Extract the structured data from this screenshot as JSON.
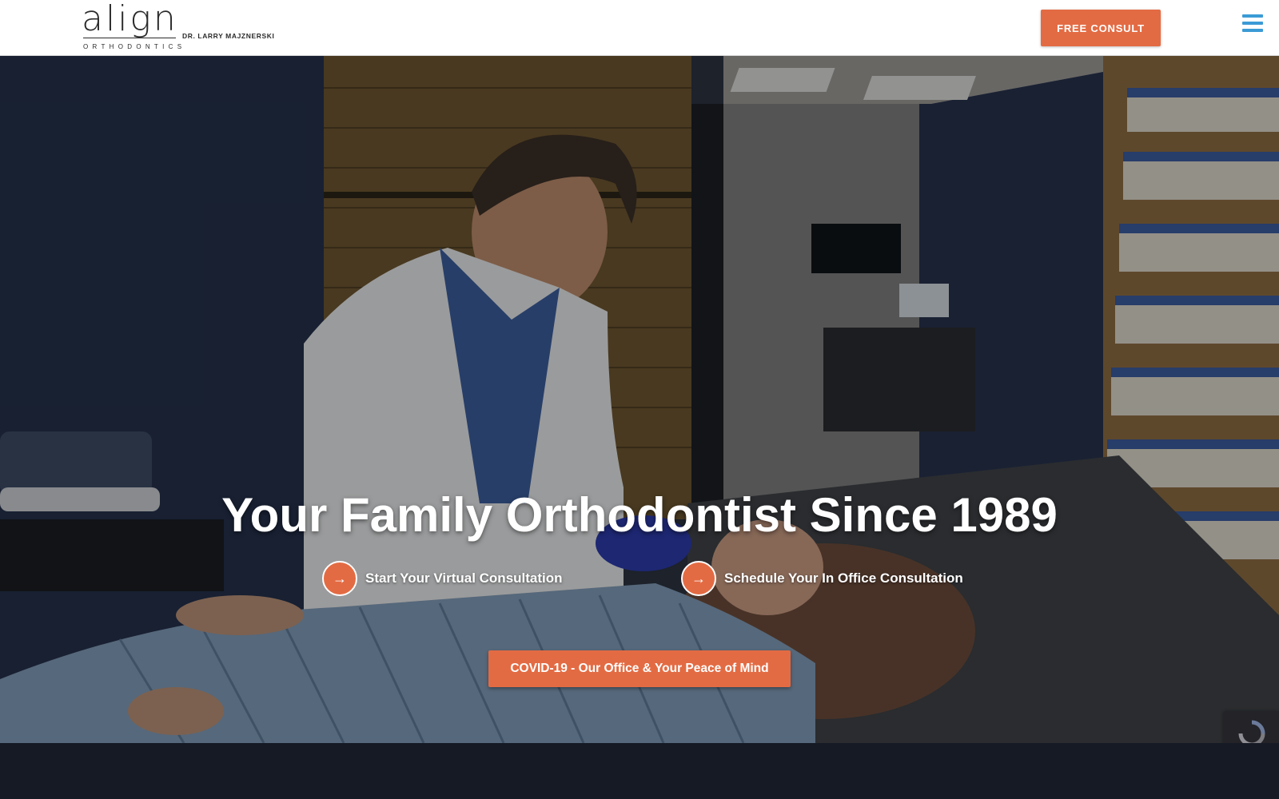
{
  "header": {
    "logo_word": "align",
    "logo_sub": "ORTHODONTICS",
    "doctor": "DR. LARRY MAJZNERSKI",
    "consult_label": "FREE CONSULT",
    "menu_icon": "hamburger-menu-icon"
  },
  "hero": {
    "title": "Your Family Orthodontist Since 1989",
    "links": [
      {
        "label": "Start Your Virtual Consultation",
        "icon": "arrow-right-icon"
      },
      {
        "label": "Schedule Your In Office Consultation",
        "icon": "arrow-right-icon"
      }
    ],
    "covid_label": "COVID-19 - Our Office & Your Peace of Mind",
    "recaptcha_icon": "recaptcha-icon"
  },
  "colors": {
    "accent": "#e36b43",
    "menu": "#3b9bd6",
    "dark_band": "#151a25"
  }
}
